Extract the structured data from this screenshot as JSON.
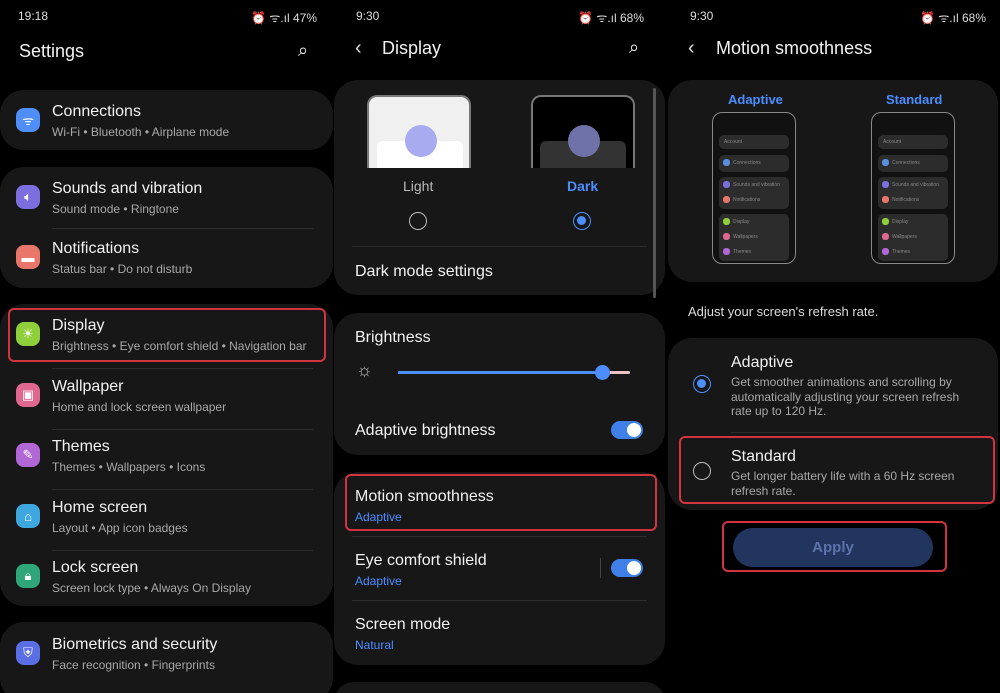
{
  "colors": {
    "accent": "#4c8dff",
    "highlight": "#d2343f",
    "card": "#171717"
  },
  "panel1": {
    "status": {
      "time": "19:18",
      "battery": "47%"
    },
    "title": "Settings",
    "search_icon": "search-icon",
    "items": [
      {
        "title": "Connections",
        "subtitle": "Wi-Fi  •  Bluetooth  •  Airplane mode",
        "icon": "wifi-icon",
        "color": "#4f8ef7"
      },
      {
        "title": "Sounds and vibration",
        "subtitle": "Sound mode  •  Ringtone",
        "icon": "speaker-icon",
        "color": "#7b6fe0"
      },
      {
        "title": "Notifications",
        "subtitle": "Status bar  •  Do not disturb",
        "icon": "notification-icon",
        "color": "#e8766a"
      },
      {
        "title": "Display",
        "subtitle": "Brightness  •  Eye comfort shield  •  Navigation bar",
        "icon": "sun-icon",
        "color": "#8fcf3b"
      },
      {
        "title": "Wallpaper",
        "subtitle": "Home and lock screen wallpaper",
        "icon": "image-icon",
        "color": "#e0678f"
      },
      {
        "title": "Themes",
        "subtitle": "Themes  •  Wallpapers  •  Icons",
        "icon": "brush-icon",
        "color": "#b167d6"
      },
      {
        "title": "Home screen",
        "subtitle": "Layout  •  App icon badges",
        "icon": "home-icon",
        "color": "#3fa7e0"
      },
      {
        "title": "Lock screen",
        "subtitle": "Screen lock type  •  Always On Display",
        "icon": "lock-icon",
        "color": "#2ea67a"
      },
      {
        "title": "Biometrics and security",
        "subtitle": "Face recognition  •  Fingerprints",
        "icon": "shield-icon",
        "color": "#5a6fe6"
      }
    ]
  },
  "panel2": {
    "status": {
      "time": "9:30",
      "battery": "68%"
    },
    "title": "Display",
    "modes": [
      {
        "label": "Light",
        "selected": false
      },
      {
        "label": "Dark",
        "selected": true
      }
    ],
    "dark_mode_settings": "Dark mode settings",
    "brightness": {
      "label": "Brightness",
      "value_percent": 88
    },
    "adaptive_brightness": {
      "label": "Adaptive brightness",
      "on": true
    },
    "motion": {
      "title": "Motion smoothness",
      "value": "Adaptive"
    },
    "eye": {
      "title": "Eye comfort shield",
      "value": "Adaptive",
      "on": true
    },
    "screen_mode": {
      "title": "Screen mode",
      "value": "Natural"
    }
  },
  "panel3": {
    "status": {
      "time": "9:30",
      "battery": "68%"
    },
    "title": "Motion smoothness",
    "preview": {
      "left": "Adaptive",
      "right": "Standard",
      "mini_search": "Account",
      "mini_items_left": [
        "Connections",
        "Sounds and vibration",
        "Notifications",
        "Display",
        "Wallpapers",
        "Themes"
      ],
      "mini_items_right": [
        "Connections",
        "Sounds and vibration",
        "Notifications",
        "Display",
        "Wallpapers",
        "Themes"
      ]
    },
    "description": "Adjust your screen's refresh rate.",
    "options": [
      {
        "title": "Adaptive",
        "desc": "Get smoother animations and scrolling by automatically adjusting your screen refresh rate up to 120 Hz.",
        "selected": true
      },
      {
        "title": "Standard",
        "desc": "Get longer battery life with a 60 Hz screen refresh rate.",
        "selected": false
      }
    ],
    "apply": "Apply"
  }
}
